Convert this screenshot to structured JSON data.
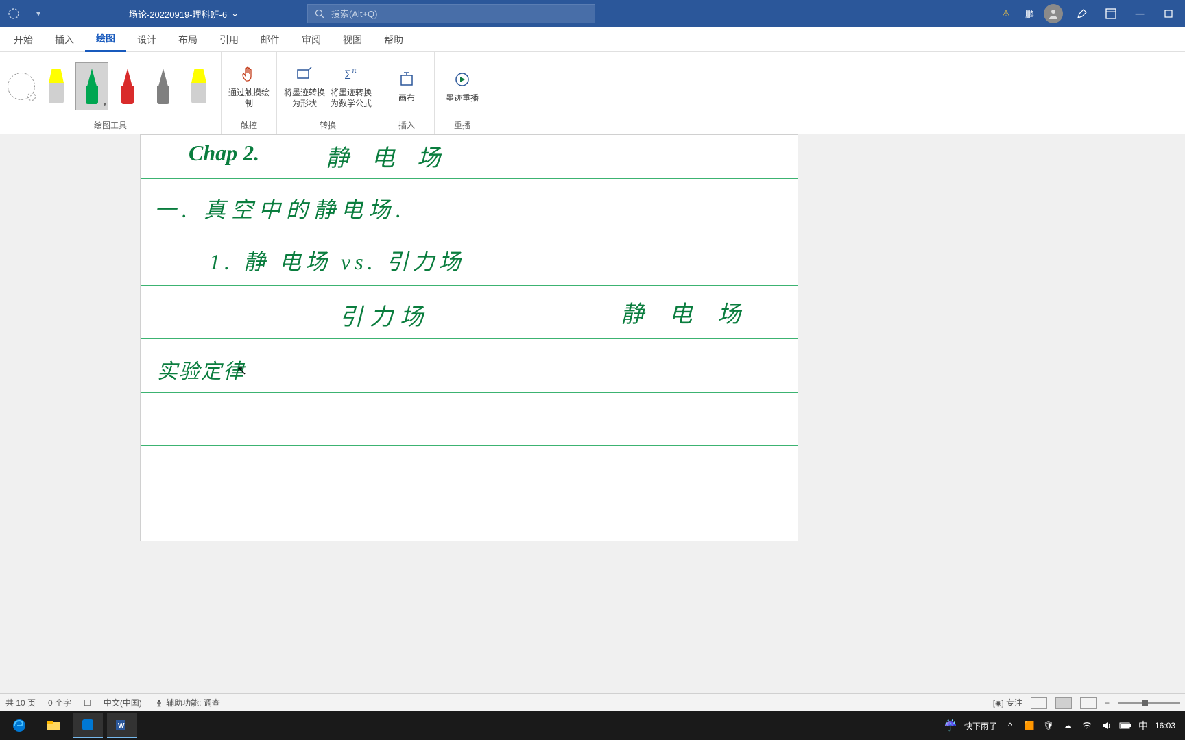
{
  "titlebar": {
    "doc_name": "场论-20220919-理科班-6",
    "search_placeholder": "搜索(Alt+Q)",
    "user_short": "鹏"
  },
  "tabs": {
    "start": "开始",
    "insert": "插入",
    "draw": "绘图",
    "design": "设计",
    "layout": "布局",
    "references": "引用",
    "mail": "邮件",
    "review": "审阅",
    "view": "视图",
    "help": "帮助"
  },
  "ribbon": {
    "draw_tools": "绘图工具",
    "touch_draw": "通过触摸绘制",
    "touch": "触控",
    "ink_to_shape": "将墨迹转换为形状",
    "ink_to_math": "将墨迹转换为数学公式",
    "convert": "转换",
    "canvas": "画布",
    "insert_g": "插入",
    "ink_replay": "墨迹重播",
    "replay": "重播"
  },
  "handwriting": {
    "l1a": "Chap 2.",
    "l1b": "静 电 场",
    "l2": "一. 真空中的静电场.",
    "l3": "1. 静 电场   vs.   引力场",
    "l4a": "引力场",
    "l4b": "静 电 场",
    "l5": "实验定律"
  },
  "statusbar": {
    "pages": "共 10 页",
    "words": "0 个字",
    "lang_icon": "☐",
    "lang": "中文(中国)",
    "acc": "辅助功能: 调查",
    "focus": "专注"
  },
  "taskbar": {
    "weather": "快下雨了",
    "ime": "中",
    "time": "16:03"
  },
  "colors": {
    "pen_yellow_hl": "#ffff00",
    "pen_green": "#00a651",
    "pen_red": "#d92b2b",
    "pen_gray": "#808080",
    "pen_yellow": "#ffff00"
  }
}
